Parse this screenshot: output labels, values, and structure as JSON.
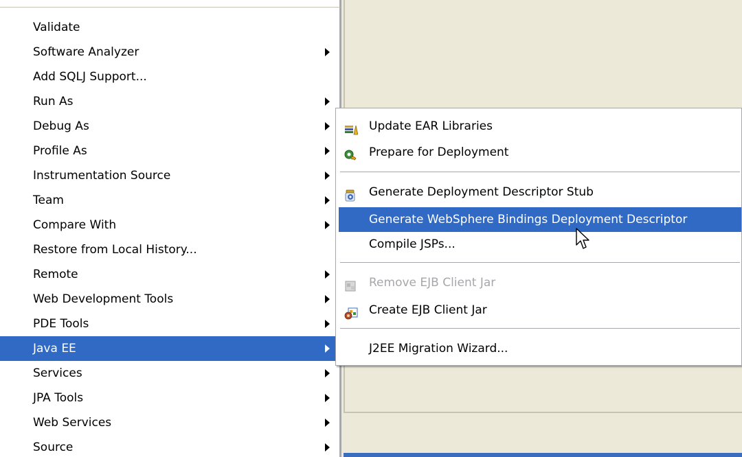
{
  "context_menu": {
    "items": [
      {
        "label": "Validate",
        "has_submenu": false
      },
      {
        "label": "Software Analyzer",
        "has_submenu": true
      },
      {
        "label": "Add SQLJ Support...",
        "has_submenu": false
      },
      {
        "label": "Run As",
        "has_submenu": true
      },
      {
        "label": "Debug As",
        "has_submenu": true
      },
      {
        "label": "Profile As",
        "has_submenu": true
      },
      {
        "label": "Instrumentation Source",
        "has_submenu": true
      },
      {
        "label": "Team",
        "has_submenu": true
      },
      {
        "label": "Compare With",
        "has_submenu": true
      },
      {
        "label": "Restore from Local History...",
        "has_submenu": false
      },
      {
        "label": "Remote",
        "has_submenu": true
      },
      {
        "label": "Web Development Tools",
        "has_submenu": true
      },
      {
        "label": "PDE Tools",
        "has_submenu": true
      },
      {
        "label": "Java EE",
        "has_submenu": true,
        "selected": true
      },
      {
        "label": "Services",
        "has_submenu": true
      },
      {
        "label": "JPA Tools",
        "has_submenu": true
      },
      {
        "label": "Web Services",
        "has_submenu": true
      },
      {
        "label": "Source",
        "has_submenu": true
      }
    ]
  },
  "submenu": {
    "items": [
      {
        "label": "Update EAR Libraries",
        "icon": "library-books-icon"
      },
      {
        "label": "Prepare for Deployment",
        "icon": "deploy-gear-icon"
      },
      {
        "label": "Generate Deployment Descriptor Stub",
        "icon": "descriptor-jar-icon"
      },
      {
        "label": "Generate WebSphere Bindings Deployment Descriptor",
        "icon": "",
        "selected": true
      },
      {
        "label": "Compile JSPs...",
        "icon": ""
      },
      {
        "label": "Remove EJB Client Jar",
        "icon": "remove-client-jar-icon",
        "disabled": true
      },
      {
        "label": "Create EJB Client Jar",
        "icon": "create-client-jar-icon"
      },
      {
        "label": "J2EE Migration Wizard...",
        "icon": ""
      }
    ]
  },
  "colors": {
    "selection": "#316ac5",
    "menu_background": "#ffffff",
    "workbench_background": "#ece9d8",
    "disabled_text": "#a7a6aa"
  }
}
